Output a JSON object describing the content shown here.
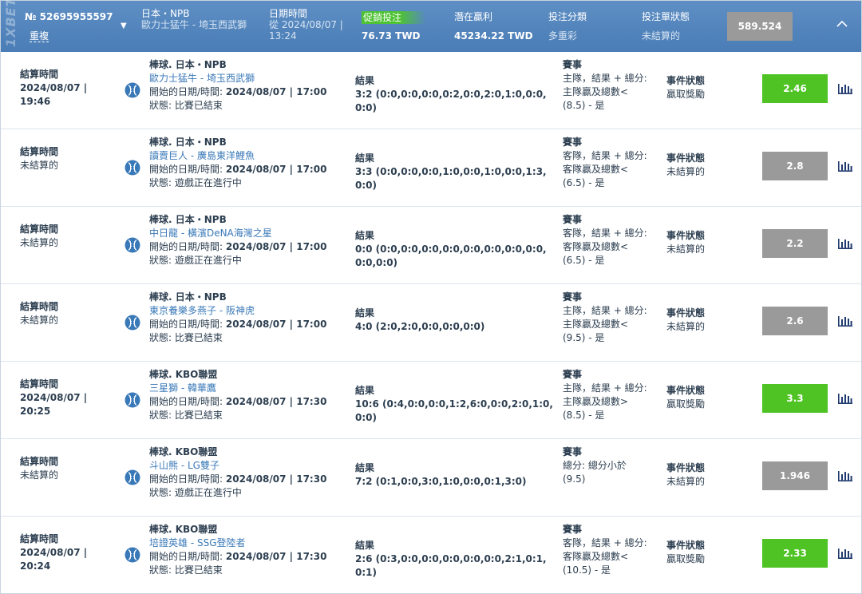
{
  "header": {
    "brand": "1XBET",
    "coupon_number": "№ 52695955597",
    "duplicate_label": "重複",
    "league_label": "日本・NPB",
    "league_match": "歐力士猛牛 - 埼玉西武獅",
    "date_label": "日期時間",
    "date_value": "從 2024/08/07 | 13:24",
    "promo_label": "促銷投注",
    "promo_amount": "76.73 TWD",
    "potential_label": "潛在贏利",
    "potential_amount": "45234.22 TWD",
    "bet_type_label": "投注分類",
    "bet_type_value": "多重彩",
    "bet_status_label": "投注單狀態",
    "bet_status_value": "未結算的",
    "total_odds": "589.524"
  },
  "labels": {
    "settle_time": "結算時間",
    "start": "開始的日期/時間:",
    "status": "狀態:",
    "result": "結果",
    "market": "賽事",
    "event_status": "事件狀態"
  },
  "colors": {
    "header_blue": "#4a7cb6",
    "win_green": "#4ec323",
    "pending_grey": "#9a9a9a",
    "team_link": "#3a79b8"
  },
  "rows": [
    {
      "settle_value": "2024/08/07 | 19:46",
      "settled": true,
      "sport": "棒球. 日本・NPB",
      "teams": "歐力士猛牛 - 埼玉西武獅",
      "start_value": "2024/08/07 | 17:00",
      "status_value": "比賽已結束",
      "result_value": "3:2 (0:0,0:0,0:0,0:2,0:0,2:0,1:0,0:0,0:0)",
      "market_value": "主隊，結果 + 總分: 主隊贏及總數< (8.5) - 是",
      "event_status_value": "贏取獎勵",
      "odds": "2.46",
      "win": true
    },
    {
      "settle_value": "未結算的",
      "settled": false,
      "sport": "棒球. 日本・NPB",
      "teams": "讀賣巨人 - 廣島東洋鯉魚",
      "start_value": "2024/08/07 | 17:00",
      "status_value": "遊戲正在進行中",
      "result_value": "3:3 (0:0,0:0,0:0,1:0,0:0,1:0,0:0,1:3,0:0)",
      "market_value": "客隊，結果 + 總分: 客隊贏及總數< (6.5) - 是",
      "event_status_value": "未結算的",
      "odds": "2.8",
      "win": false
    },
    {
      "settle_value": "未結算的",
      "settled": false,
      "sport": "棒球. 日本・NPB",
      "teams": "中日龍 - 橫濱DeNA海灣之星",
      "start_value": "2024/08/07 | 17:00",
      "status_value": "遊戲正在進行中",
      "result_value": "0:0 (0:0,0:0,0:0,0:0,0:0,0:0,0:0,0:0,0:0,0:0)",
      "market_value": "客隊，結果 + 總分: 客隊贏及總數< (6.5) - 是",
      "event_status_value": "未結算的",
      "odds": "2.2",
      "win": false
    },
    {
      "settle_value": "未結算的",
      "settled": false,
      "sport": "棒球. 日本・NPB",
      "teams": "東京養樂多燕子 - 阪神虎",
      "start_value": "2024/08/07 | 17:00",
      "status_value": "比賽已結束",
      "result_value": "4:0 (2:0,2:0,0:0,0:0,0:0)",
      "market_value": "主隊，結果 + 總分: 主隊贏及總數< (9.5) - 是",
      "event_status_value": "未結算的",
      "odds": "2.6",
      "win": false
    },
    {
      "settle_value": "2024/08/07 | 20:25",
      "settled": true,
      "sport": "棒球. KBO聯盟",
      "teams": "三星獅 - 韓華鷹",
      "start_value": "2024/08/07 | 17:30",
      "status_value": "比賽已結束",
      "result_value": "10:6 (0:4,0:0,0:0,1:2,6:0,0:0,2:0,1:0,0:0)",
      "market_value": "主隊，結果 + 總分: 主隊贏及總數> (8.5) - 是",
      "event_status_value": "贏取獎勵",
      "odds": "3.3",
      "win": true
    },
    {
      "settle_value": "未結算的",
      "settled": false,
      "sport": "棒球. KBO聯盟",
      "teams": "斗山熊 - LG雙子",
      "start_value": "2024/08/07 | 17:30",
      "status_value": "遊戲正在進行中",
      "result_value": "7:2 (0:1,0:0,3:0,1:0,0:0,0:1,3:0)",
      "market_value": "總分: 總分小於 (9.5)",
      "event_status_value": "未結算的",
      "odds": "1.946",
      "win": false
    },
    {
      "settle_value": "2024/08/07 | 20:24",
      "settled": true,
      "sport": "棒球. KBO聯盟",
      "teams": "培證英雄 - SSG登陸者",
      "start_value": "2024/08/07 | 17:30",
      "status_value": "比賽已結束",
      "result_value": "2:6 (0:3,0:0,0:0,0:0,0:0,0:0,2:1,0:1,0:1)",
      "market_value": "客隊，結果 + 總分: 客隊贏及總數< (10.5) - 是",
      "event_status_value": "贏取獎勵",
      "odds": "2.33",
      "win": true
    }
  ]
}
